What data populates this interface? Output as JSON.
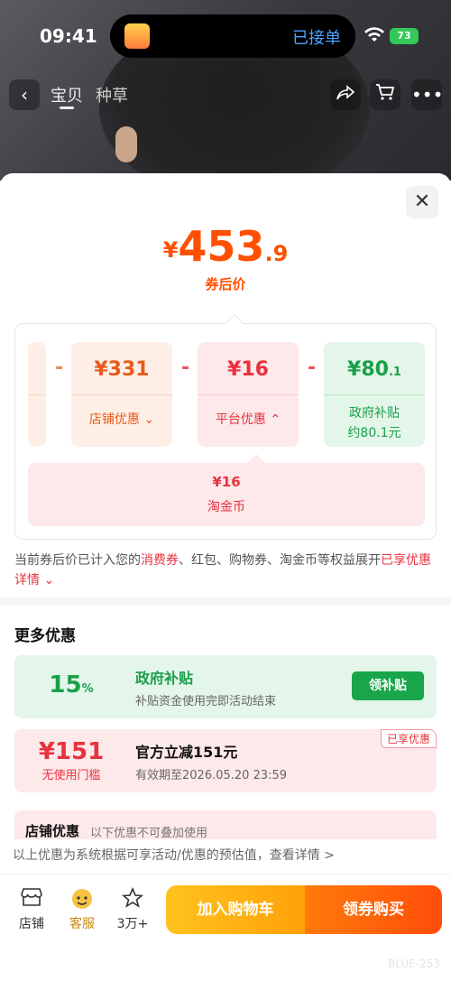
{
  "status": {
    "time": "09:41",
    "island_text": "已接单",
    "battery": "73"
  },
  "nav": {
    "tabs": [
      "宝贝",
      "种草"
    ]
  },
  "price": {
    "currency": "¥",
    "integer": "453",
    "decimal": ".9",
    "label": "券后价"
  },
  "breakdown": {
    "minus": "-",
    "shop": {
      "value": "¥331",
      "label": "店铺优惠"
    },
    "platform": {
      "value": "¥16",
      "label": "平台优惠"
    },
    "gov": {
      "value_main": "¥80",
      "value_dec": ".1",
      "label_1": "政府补贴",
      "label_2": "约80.1元"
    },
    "coin": {
      "value": "¥16",
      "label": "淘金币"
    }
  },
  "note": {
    "part1": "当前券后价已计入您的",
    "highlight": "消费券",
    "part2": "、红包、购物券、淘金币等权益展开",
    "link": "已享优惠详情"
  },
  "more": {
    "title": "更多优惠",
    "gov_offer": {
      "big": "15",
      "unit": "%",
      "title": "政府补贴",
      "desc": "补贴资金使用完即活动结束",
      "button": "领补贴"
    },
    "off_offer": {
      "big": "¥151",
      "sub": "无使用门槛",
      "title": "官方立减151元",
      "desc": "有效期至2026.05.20 23:59",
      "badge": "已享优惠"
    },
    "shop_offer": {
      "title": "店铺优惠",
      "desc": "以下优惠不可叠加使用"
    }
  },
  "estimate": "以上优惠为系统根据可享活动/优惠的预估值，查看详情 >",
  "bottom": {
    "store": "店铺",
    "service": "客服",
    "favorite": "3万+",
    "add_cart": "加入购物车",
    "buy": "领券购买"
  },
  "watermark": "BLUE-253"
}
